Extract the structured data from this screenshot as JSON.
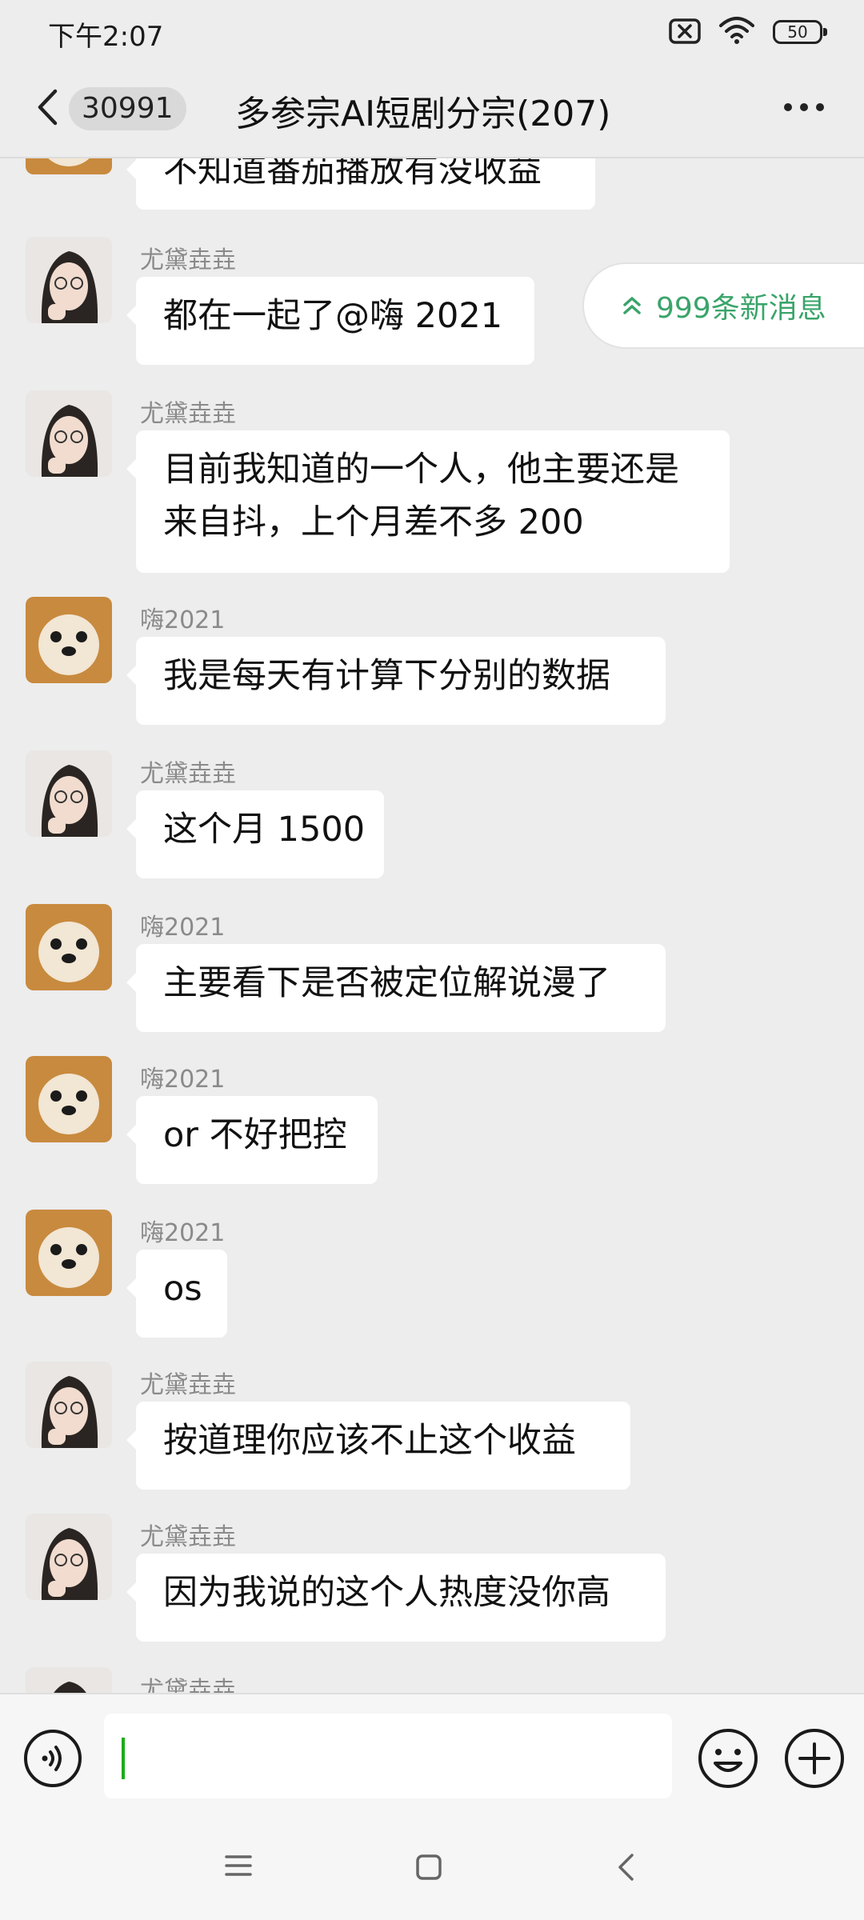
{
  "status_bar": {
    "time": "下午2:07",
    "battery": "50"
  },
  "header": {
    "unread_count": "30991",
    "title": "多参宗AI短剧分宗(207)"
  },
  "new_messages_pill": {
    "label": "999条新消息",
    "color": "#3aa46a"
  },
  "messages": [
    {
      "sender": "",
      "text": "不知道番茄播放有没收益",
      "avatar": "dog"
    },
    {
      "sender": "尤黛垚垚",
      "text": "都在一起了@嗨 2021",
      "avatar": "girl"
    },
    {
      "sender": "尤黛垚垚",
      "text": "目前我知道的一个人，他主要还是\n来自抖，上个月差不多 200",
      "avatar": "girl"
    },
    {
      "sender": "嗨2021",
      "text": "我是每天有计算下分别的数据",
      "avatar": "dog"
    },
    {
      "sender": "尤黛垚垚",
      "text": "这个月 1500",
      "avatar": "girl"
    },
    {
      "sender": "嗨2021",
      "text": "主要看下是否被定位解说漫了",
      "avatar": "dog"
    },
    {
      "sender": "嗨2021",
      "text": "or 不好把控",
      "avatar": "dog"
    },
    {
      "sender": "嗨2021",
      "text": "os",
      "avatar": "dog"
    },
    {
      "sender": "尤黛垚垚",
      "text": "按道理你应该不止这个收益",
      "avatar": "girl"
    },
    {
      "sender": "尤黛垚垚",
      "text": "因为我说的这个人热度没你高",
      "avatar": "girl"
    },
    {
      "sender": "尤黛垚垚",
      "text": "",
      "avatar": "girl"
    }
  ],
  "input_bar": {
    "value": "",
    "placeholder": ""
  },
  "icons": {
    "back": "chevron-left-icon",
    "more": "more-horizontal-icon",
    "voice": "voice-icon",
    "emoji": "emoji-icon",
    "plus": "plus-icon",
    "pill": "double-chevron-up-icon",
    "nav_menu": "menu-icon",
    "nav_home": "home-square-icon",
    "nav_back": "nav-back-icon"
  },
  "colors": {
    "background": "#ededed",
    "accent": "#1aad19",
    "bubble": "#ffffff"
  }
}
